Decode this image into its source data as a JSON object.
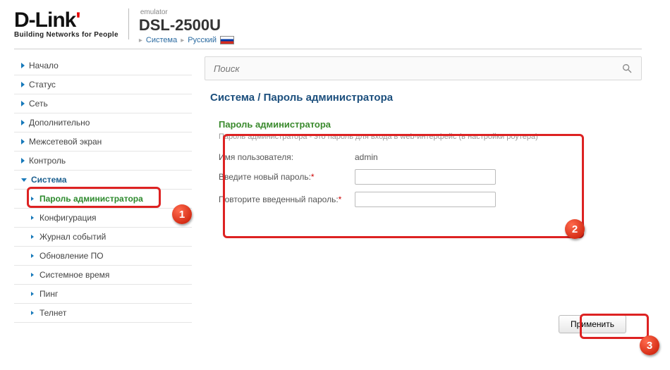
{
  "brand": {
    "name_part1": "D",
    "name_part2": "-Link",
    "accent_char": "'",
    "tagline": "Building Networks for People"
  },
  "model": {
    "emulator_label": "emulator",
    "name": "DSL-2500U"
  },
  "breadcrumb": {
    "item1": "Система",
    "item2": "Русский"
  },
  "nav": {
    "items": [
      "Начало",
      "Статус",
      "Сеть",
      "Дополнительно",
      "Межсетевой экран",
      "Контроль"
    ],
    "expanded": "Система",
    "children": [
      "Пароль администратора",
      "Конфигурация",
      "Журнал событий",
      "Обновление ПО",
      "Системное время",
      "Пинг",
      "Телнет"
    ]
  },
  "search": {
    "placeholder": "Поиск"
  },
  "page_title": "Система /  Пароль администратора",
  "panel": {
    "heading": "Пароль администратора",
    "description": "Пароль администратора - это пароль для входа в web-интерфейс (в настройки роутера)"
  },
  "form": {
    "username_label": "Имя пользователя:",
    "username_value": "admin",
    "newpw_label": "Введите новый пароль:",
    "confirmpw_label": "Повторите введенный пароль:"
  },
  "buttons": {
    "apply": "Применить"
  },
  "badges": {
    "b1": "1",
    "b2": "2",
    "b3": "3"
  }
}
